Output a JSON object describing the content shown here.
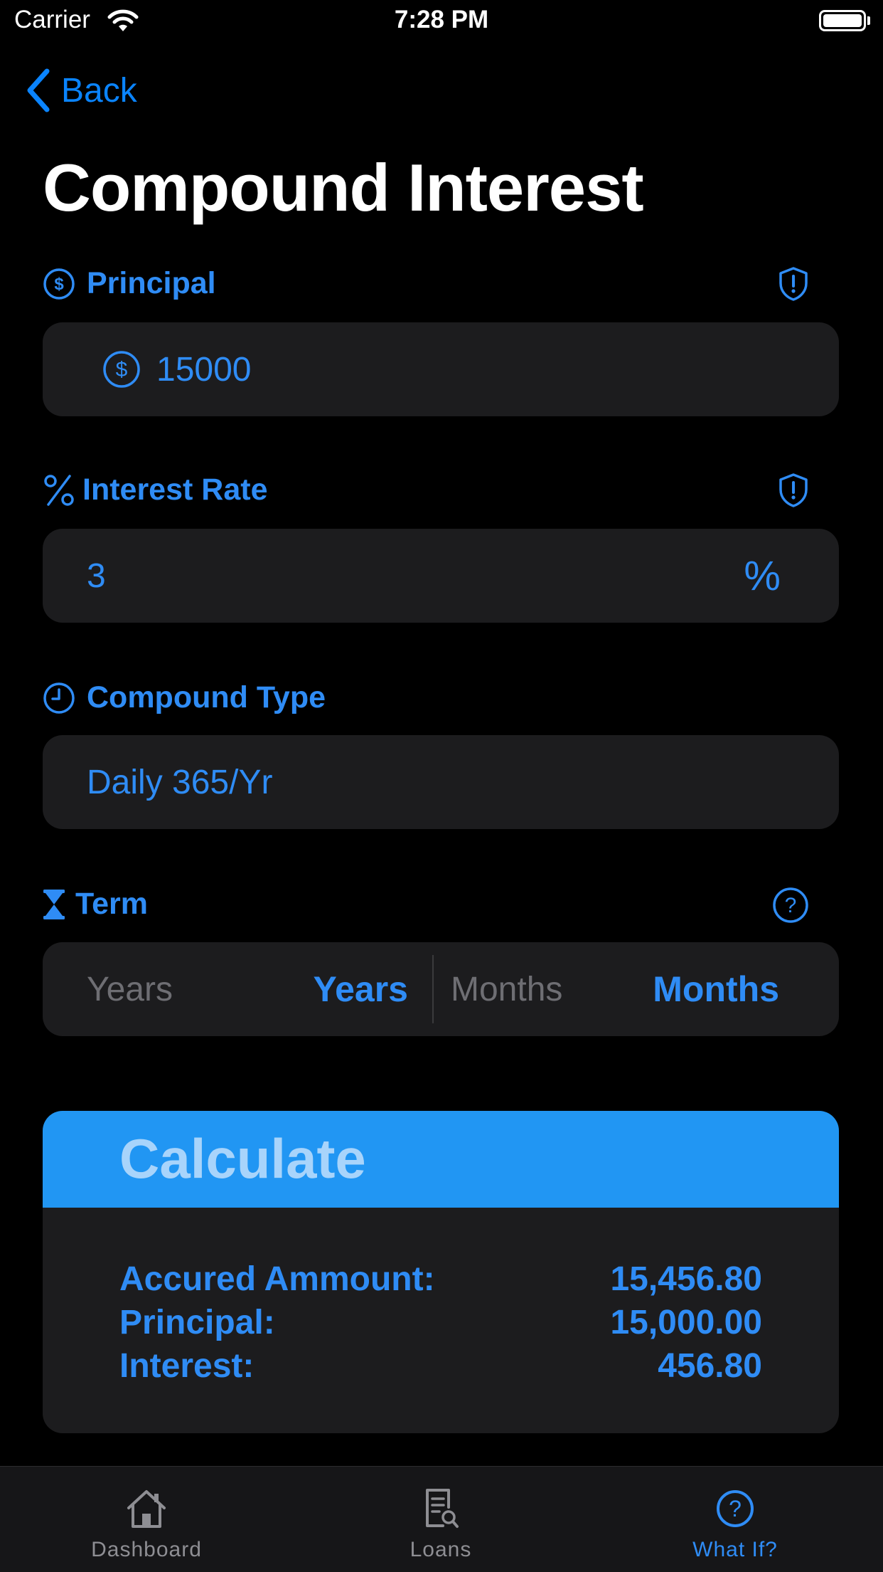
{
  "status_bar": {
    "carrier": "Carrier",
    "time": "7:28 PM"
  },
  "nav": {
    "back_label": "Back"
  },
  "page": {
    "title": "Compound Interest"
  },
  "principal": {
    "label": "Principal",
    "value": "15000"
  },
  "interest_rate": {
    "label": "Interest Rate",
    "value": "3",
    "suffix": "%"
  },
  "compound_type": {
    "label": "Compound Type",
    "value": "Daily 365/Yr"
  },
  "term": {
    "label": "Term",
    "years_placeholder": "Years",
    "years_label": "Years",
    "months_placeholder": "Months",
    "months_label": "Months"
  },
  "calculate": {
    "button_label": "Calculate"
  },
  "results": [
    {
      "label": "Accured Ammount:",
      "value": "15,456.80"
    },
    {
      "label": "Principal:",
      "value": "15,000.00"
    },
    {
      "label": "Interest:",
      "value": "456.80"
    }
  ],
  "tabs": [
    {
      "label": "Dashboard",
      "icon": "house-icon"
    },
    {
      "label": "Loans",
      "icon": "document-search-icon"
    },
    {
      "label": "What If?",
      "icon": "question-circle-icon"
    }
  ],
  "colors": {
    "accent": "#2f8cf5",
    "button": "#2196f3",
    "field_bg": "#1c1c1e",
    "inactive_tab": "#8e8e93"
  }
}
